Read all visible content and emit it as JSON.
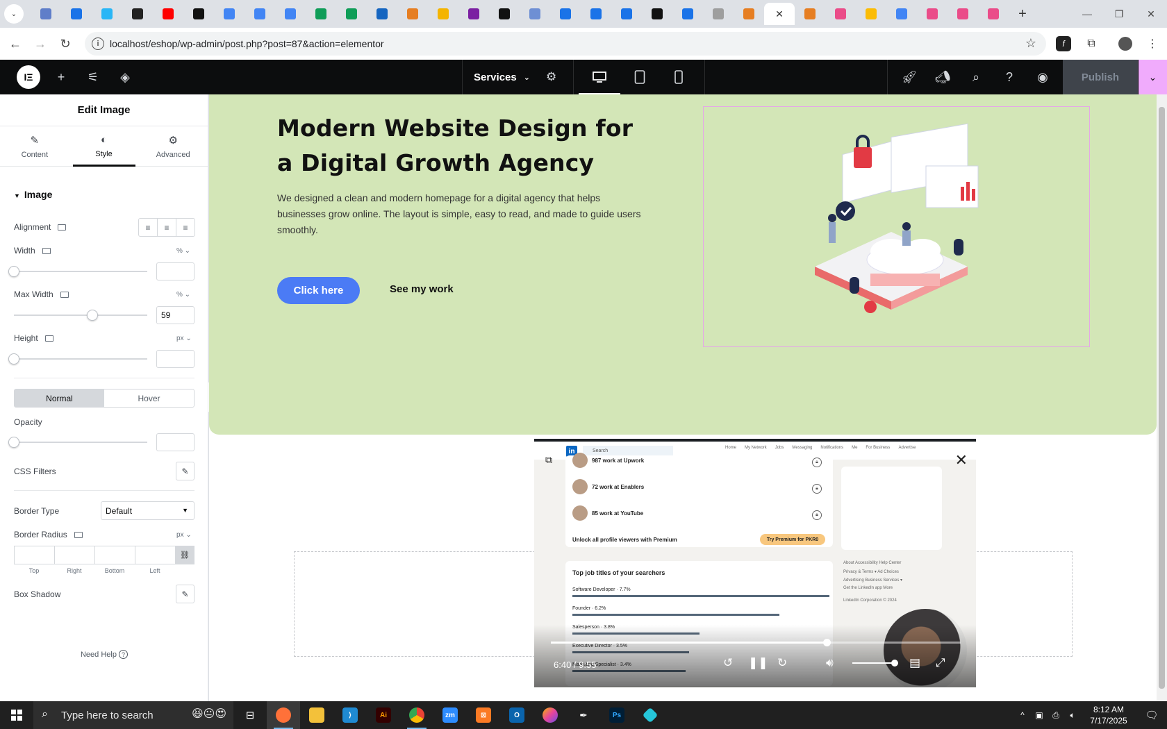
{
  "browser": {
    "url": "localhost/eshop/wp-admin/post.php?post=87&action=elementor",
    "tab_favicon_colors": [
      "#5f7ec9",
      "#1a73e8",
      "#29b6f6",
      "#222222",
      "#ff0000",
      "#111111",
      "#4285f4",
      "#4285f4",
      "#4285f4",
      "#0f9d58",
      "#0f9d58",
      "#1565c0",
      "#e67e22",
      "#f4b400",
      "#7b1fa2",
      "#111111",
      "#6e8fd4",
      "#1a73e8",
      "#1a73e8",
      "#1a73e8",
      "#111111",
      "#1a73e8",
      "#9e9e9e",
      "#e67e22"
    ],
    "after_tab_colors": [
      "#e67e22",
      "#ea4c89",
      "#fbbc05",
      "#4285f4",
      "#ea4c89",
      "#ea4c89",
      "#ea4c89"
    ]
  },
  "elementor": {
    "page_name": "Services",
    "publish_label": "Publish",
    "accent": "#f0abfc"
  },
  "panel": {
    "title": "Edit Image",
    "tabs": [
      {
        "label": "Content",
        "icon": "pencil-icon"
      },
      {
        "label": "Style",
        "icon": "contrast-icon",
        "active": true
      },
      {
        "label": "Advanced",
        "icon": "gear-icon"
      }
    ],
    "section": "Image",
    "alignment_label": "Alignment",
    "width_label": "Width",
    "width_unit": "%",
    "width_value": "",
    "max_width_label": "Max Width",
    "max_width_unit": "%",
    "max_width_value": "59",
    "height_label": "Height",
    "height_unit": "px",
    "height_value": "",
    "normal_label": "Normal",
    "hover_label": "Hover",
    "opacity_label": "Opacity",
    "opacity_value": "",
    "css_filters_label": "CSS Filters",
    "border_type_label": "Border Type",
    "border_type_value": "Default",
    "border_radius_label": "Border Radius",
    "border_radius_unit": "px",
    "dim_labels": [
      "Top",
      "Right",
      "Bottom",
      "Left"
    ],
    "box_shadow_label": "Box Shadow",
    "need_help": "Need Help"
  },
  "hero": {
    "heading": "Modern Website Design for a Digital Growth Agency",
    "paragraph": "We designed a clean and modern homepage for a digital agency that helps businesses grow online. The layout is simple, easy to read, and made to guide users smoothly.",
    "primary_button": "Click here",
    "secondary_link": "See my work",
    "bg_color": "#d3e6b7",
    "button_color": "#4b7bf5"
  },
  "video": {
    "search_placeholder": "Search",
    "nav": [
      "Home",
      "My Network",
      "Jobs",
      "Messaging",
      "Notifications",
      "Me",
      "For Business",
      "Advertise"
    ],
    "rows": [
      "987 work at Upwork",
      "72 work at Enablers",
      "85 work at YouTube"
    ],
    "unlock_text": "Unlock all profile viewers with Premium",
    "premium_btn": "Try Premium for PKR0",
    "job_titles_heading": "Top job titles of your searchers",
    "job_titles": [
      {
        "label": "Software Developer · 7.7%",
        "pct": 7.7
      },
      {
        "label": "Founder · 6.2%",
        "pct": 6.2
      },
      {
        "label": "Salesperson · 3.8%",
        "pct": 3.8
      },
      {
        "label": "Executive Director · 3.5%",
        "pct": 3.5
      },
      {
        "label": "Marketing Specialist · 3.4%",
        "pct": 3.4
      }
    ],
    "footer_lines": [
      "About   Accessibility   Help Center",
      "Privacy & Terms ▾   Ad Choices",
      "Advertising   Business Services ▾",
      "Get the LinkedIn app   More",
      "LinkedIn Corporation © 2024"
    ],
    "time": "6:40 / 9:55",
    "progress": 0.6723
  },
  "taskbar": {
    "search_placeholder": "Type here to search",
    "time": "8:12 AM",
    "date": "7/17/2025"
  }
}
